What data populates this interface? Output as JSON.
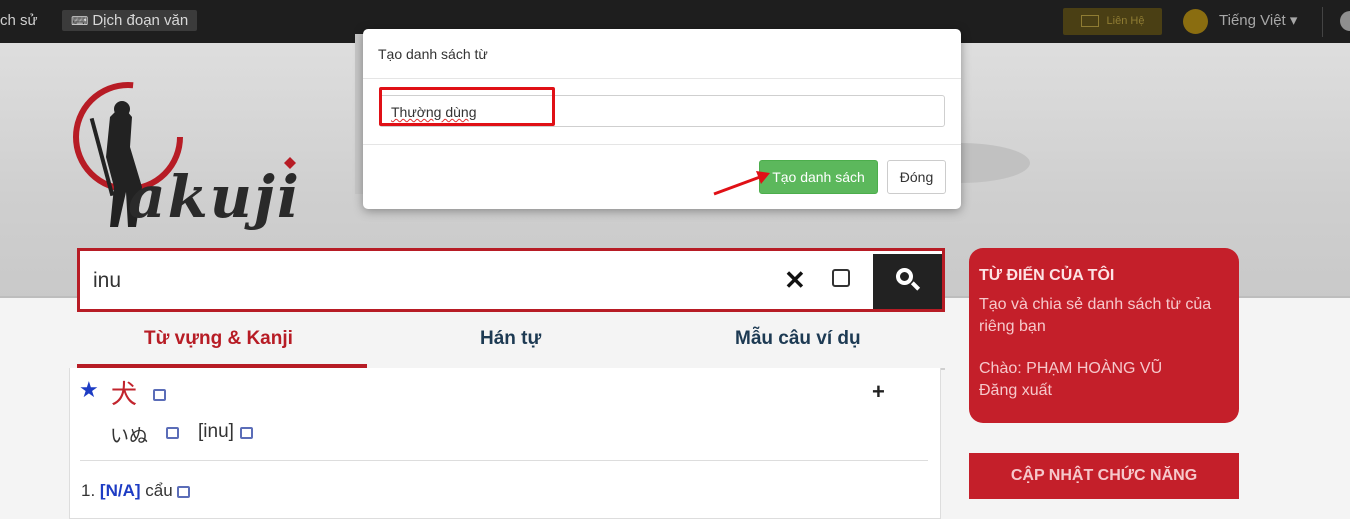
{
  "topbar": {
    "history_label": "ch sử",
    "translate_label": "Dịch đoạn văn",
    "contact_label": "Liên Hệ",
    "language_label": "Tiếng Việt"
  },
  "logo": {
    "text": "akuji"
  },
  "search": {
    "query": "inu"
  },
  "tabs": [
    {
      "label": "Từ vựng & Kanji",
      "active": true
    },
    {
      "label": "Hán tự",
      "active": false
    },
    {
      "label": "Mẫu câu ví dụ",
      "active": false
    }
  ],
  "entry": {
    "kanji": "犬",
    "kana": "いぬ",
    "romaji": "[inu]",
    "meaning_index": "1.",
    "meaning_pos": "[N/A]",
    "meaning_text": "cẩu"
  },
  "sidebar": {
    "title": "TỪ ĐIỂN CỦA TÔI",
    "description": "Tạo và chia sẻ danh sách từ của riêng bạn",
    "greeting": "Chào: PHẠM HOÀNG VŨ",
    "logout": "Đăng xuất",
    "update_title": "CẬP NHẬT CHỨC NĂNG"
  },
  "modal": {
    "title": "Tạo danh sách từ",
    "input_value": "Thường dùng",
    "create_label": "Tạo danh sách",
    "close_label": "Đóng"
  },
  "colors": {
    "brand_red": "#c41f2a",
    "create_green": "#5cb85c",
    "highlight_red": "#e01016"
  }
}
